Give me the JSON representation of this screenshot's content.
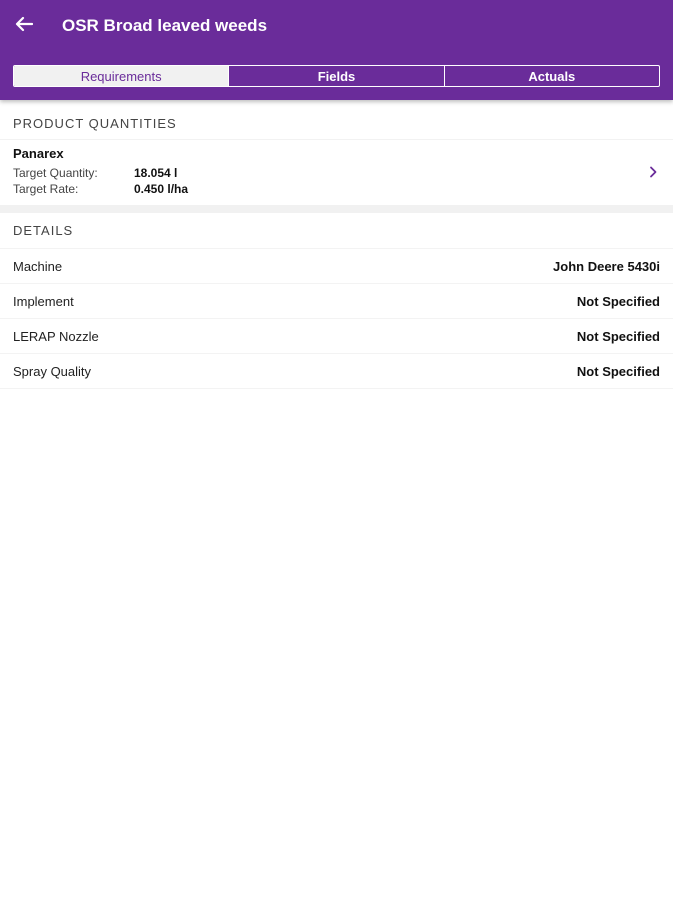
{
  "header": {
    "title": "OSR Broad leaved weeds",
    "back_icon": "arrow-left-icon"
  },
  "tabs": [
    {
      "label": "Requirements",
      "active": true
    },
    {
      "label": "Fields",
      "active": false
    },
    {
      "label": "Actuals",
      "active": false
    }
  ],
  "product_quantities": {
    "section_title": "PRODUCT QUANTITIES",
    "items": [
      {
        "name": "Panarex",
        "target_quantity_label": "Target Quantity:",
        "target_quantity_value": "18.054 l",
        "target_rate_label": "Target Rate:",
        "target_rate_value": "0.450 l/ha",
        "chevron_icon": "chevron-right-icon"
      }
    ]
  },
  "details": {
    "section_title": "DETAILS",
    "rows": [
      {
        "label": "Machine",
        "value": "John Deere 5430i"
      },
      {
        "label": "Implement",
        "value": "Not Specified"
      },
      {
        "label": "LERAP Nozzle",
        "value": "Not Specified"
      },
      {
        "label": "Spray Quality",
        "value": "Not Specified"
      }
    ]
  },
  "colors": {
    "brand": "#6a2c9a",
    "tab_active_bg": "#f1f1f1"
  }
}
